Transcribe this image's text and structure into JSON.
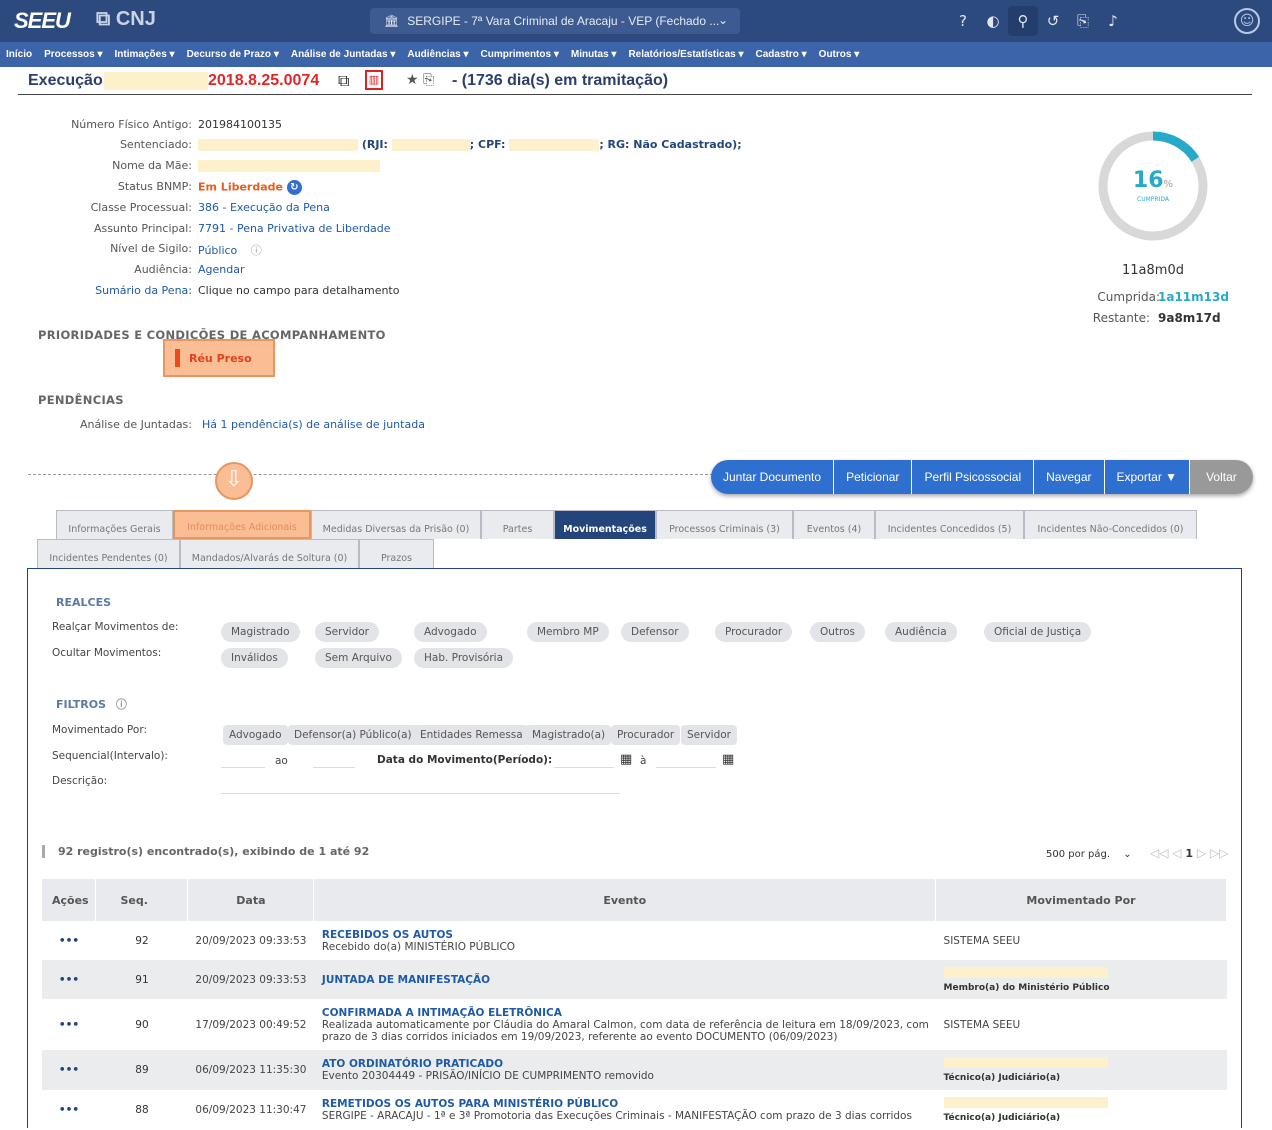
{
  "topbar": {
    "logo": "SEEU",
    "cnj": "CNJ",
    "court": "SERGIPE - 7ª Vara Criminal de Aracaju - VEP (Fechado ..."
  },
  "menu": [
    "Início",
    "Processos ▾",
    "Intimações ▾",
    "Decurso de Prazo ▾",
    "Análise de Juntadas ▾",
    "Audiências ▾",
    "Cumprimentos ▾",
    "Minutas ▾",
    "Relatórios/Estatísticas ▾",
    "Cadastro ▾",
    "Outros ▾"
  ],
  "title": {
    "prefix": "Execução",
    "number": "2018.8.25.0074",
    "tramitacao": "-  (1736 dia(s) em tramitação)"
  },
  "info": {
    "numero_fisico_label": "Número Físico Antigo:",
    "numero_fisico": "201984100135",
    "sentenciado_label": "Sentenciado:",
    "rji": "(RJI:",
    "cpf": "; CPF:",
    "rg": "; RG: Não Cadastrado);",
    "mae_label": "Nome da Mãe:",
    "bnmp_label": "Status BNMP:",
    "bnmp": "Em Liberdade",
    "classe_label": "Classe Processual:",
    "classe": "386 - Execução da Pena",
    "assunto_label": "Assunto Principal:",
    "assunto": "7791 - Pena Privativa de Liberdade",
    "sigilo_label": "Nível de Sigilo:",
    "sigilo": "Público",
    "audiencia_label": "Audiência:",
    "audiencia": "Agendar",
    "sumario_label": "Sumário da Pena:",
    "sumario": "Clique no campo para detalhamento"
  },
  "prioridades": {
    "title": "PRIORIDADES E CONDIÇÕES DE ACOMPANHAMENTO",
    "reu": "Réu Preso"
  },
  "pendencias": {
    "title": "PENDÊNCIAS",
    "label": "Análise de Juntadas:",
    "value": "Há 1 pendência(s) de análise de juntada"
  },
  "pena": {
    "percent_num": "16",
    "percent_sign": "%",
    "percent_value": 16,
    "cumprida_small": "CUMPRIDA",
    "total": "11a8m0d",
    "cumprida_label": "Cumprida:",
    "cumprida": "1a11m13d",
    "restante_label": "Restante:",
    "restante": "9a8m17d",
    "accent": "#27a9c9"
  },
  "actions": [
    "Juntar Documento",
    "Peticionar",
    "Perfil Psicossocial",
    "Navegar",
    "Exportar ▼",
    "Voltar"
  ],
  "tabs1": [
    "Informações Gerais",
    "Informações Adicionais",
    "Medidas Diversas da Prisão (0)",
    "Partes",
    "Movimentações",
    "Processos Criminais (3)",
    "Eventos (4)",
    "Incidentes Concedidos (5)",
    "Incidentes Não-Concedidos (0)"
  ],
  "tabs2": [
    "Incidentes Pendentes (0)",
    "Mandados/Alvarás de Soltura (0)",
    "Prazos"
  ],
  "realces": {
    "title": "REALCES",
    "realcar_label": "Realçar Movimentos de:",
    "ocultar_label": "Ocultar Movimentos:",
    "realcar": [
      "Magistrado",
      "Servidor",
      "Advogado",
      "Membro MP",
      "Defensor",
      "Procurador",
      "Outros",
      "Audiência",
      "Oficial de Justiça"
    ],
    "ocultar": [
      "Inválidos",
      "Sem Arquivo",
      "Hab. Provisória"
    ]
  },
  "filtros": {
    "title": "FILTROS",
    "mov_label": "Movimentado Por:",
    "mov": [
      "Advogado",
      "Defensor(a) Público(a)",
      "Entidades Remessa",
      "Magistrado(a)",
      "Procurador",
      "Servidor"
    ],
    "seq_label": "Sequencial(Intervalo):",
    "ao": "ao",
    "data_label": "Data do Movimento(Período):",
    "a": "à",
    "desc_label": "Descrição:"
  },
  "registros": "92 registro(s) encontrado(s), exibindo de 1 até 92",
  "pager": {
    "per_page": "500 por pág.",
    "page": "1"
  },
  "table": {
    "headers": [
      "Ações",
      "Seq.",
      "Data",
      "Evento",
      "Movimentado Por"
    ],
    "rows": [
      {
        "acao": "•••",
        "seq": "92",
        "data": "20/09/2023 09:33:53",
        "titulo": "RECEBIDOS OS AUTOS",
        "desc": "Recebido do(a) MINISTÉRIO PÚBLICO",
        "mov": "SISTEMA SEEU"
      },
      {
        "acao": "•••",
        "seq": "91",
        "data": "20/09/2023 09:33:53",
        "titulo": "JUNTADA DE MANIFESTAÇÃO",
        "desc": "",
        "mov": "Membro(a) do Ministério Público"
      },
      {
        "acao": "•••",
        "seq": "90",
        "data": "17/09/2023 00:49:52",
        "titulo": "CONFIRMADA A INTIMAÇÃO ELETRÔNICA",
        "desc": "Realizada automaticamente por Cláudia do Amaral Calmon, com data de referência de leitura em 18/09/2023, com prazo de 3 dias corridos iniciados em 19/09/2023, referente ao evento DOCUMENTO (06/09/2023)",
        "mov": "SISTEMA SEEU"
      },
      {
        "acao": "•••",
        "seq": "89",
        "data": "06/09/2023 11:35:30",
        "titulo": "ATO ORDINATÓRIO PRATICADO",
        "desc": "Evento 20304449 - PRISÃO/INÍCIO DE CUMPRIMENTO removido",
        "mov": "Técnico(a) Judiciário(a)"
      },
      {
        "acao": "•••",
        "seq": "88",
        "data": "06/09/2023 11:30:47",
        "titulo": "REMETIDOS OS AUTOS PARA MINISTÉRIO PÚBLICO",
        "desc": "SERGIPE - ARACAJU - 1ª e 3ª Promotoria das Execuções Criminais - MANIFESTAÇÃO com prazo de 3 dias corridos",
        "mov": "Técnico(a) Judiciário(a)"
      }
    ]
  }
}
